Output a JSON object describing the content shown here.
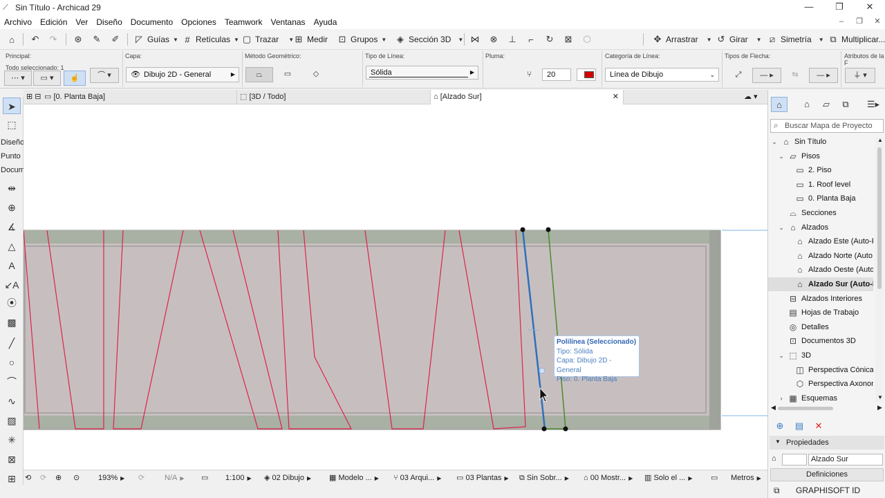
{
  "window": {
    "title": "Sin Título - Archicad 29",
    "controls": {
      "minimize": "—",
      "maximize": "❐",
      "close": "✕"
    },
    "doc_controls": {
      "minimize": "–",
      "restore": "❐",
      "close": "✕"
    }
  },
  "menu": [
    "Archivo",
    "Edición",
    "Ver",
    "Diseño",
    "Documento",
    "Opciones",
    "Teamwork",
    "Ventanas",
    "Ayuda"
  ],
  "toolbar": {
    "guias": "Guías",
    "reticulas": "Retículas",
    "trazar": "Trazar",
    "medir": "Medir",
    "grupos": "Grupos",
    "seccion3d": "Sección 3D",
    "arrastrar": "Arrastrar",
    "girar": "Girar",
    "simetria": "Simetría",
    "multiplicar": "Multiplicar..."
  },
  "infobox": {
    "principal_label": "Principal:",
    "todo_seleccionado": "Todo seleccionado: 1",
    "capa_label": "Capa:",
    "capa_value": "Dibujo 2D - General",
    "metodo_label": "Método Geométrico:",
    "tipo_linea_label": "Tipo de Línea:",
    "tipo_linea_value": "Sólida",
    "pluma_label": "Pluma:",
    "pluma_value": "20",
    "pluma_color": "#d40000",
    "categoria_label": "Categoría de Línea:",
    "categoria_value": "Línea de Dibujo",
    "flecha_label": "Tipos de Flecha:",
    "atributos_label": "Atributos de la F"
  },
  "tabs": [
    {
      "label": "[0. Planta Baja]"
    },
    {
      "label": "[3D / Todo]"
    },
    {
      "label": "[Alzado Sur]"
    }
  ],
  "toolbox": {
    "labels": [
      "Diseño",
      "Punto",
      "Docum"
    ]
  },
  "tooltip": {
    "title": "Polilínea (Seleccionado)",
    "tipo": "Tipo: Sólida",
    "capa": "Capa: Dibujo 2D - General",
    "piso": "Piso: 0. Planta Baja"
  },
  "colors": {
    "accent_blue": "#2f6fbd",
    "red_lines": "#e0204a",
    "green_line": "#4a8a2a",
    "wall_fill": "#c7bfbf",
    "wall_band": "#a9b0a4"
  },
  "navigator": {
    "search_placeholder": "Buscar Mapa de Proyecto",
    "tree": [
      {
        "label": "Sin Título",
        "icon": "house-icon",
        "twisty": "⌄"
      },
      {
        "label": "Pisos",
        "icon": "floors-icon",
        "twisty": "⌄"
      },
      {
        "label": "2. Piso",
        "icon": "floor-icon",
        "twisty": ""
      },
      {
        "label": "1. Roof level",
        "icon": "floor-icon",
        "twisty": ""
      },
      {
        "label": "0. Planta Baja",
        "icon": "floor-icon",
        "twisty": ""
      },
      {
        "label": "Secciones",
        "icon": "section-icon",
        "twisty": ""
      },
      {
        "label": "Alzados",
        "icon": "elevation-icon",
        "twisty": "⌄"
      },
      {
        "label": "Alzado Este (Auto-R",
        "icon": "elevation-icon",
        "twisty": ""
      },
      {
        "label": "Alzado Norte (Auto",
        "icon": "elevation-icon",
        "twisty": ""
      },
      {
        "label": "Alzado Oeste (Auto",
        "icon": "elevation-icon",
        "twisty": ""
      },
      {
        "label": "Alzado Sur (Auto-R",
        "icon": "elevation-icon",
        "twisty": "",
        "selected": true
      },
      {
        "label": "Alzados Interiores",
        "icon": "interior-elevation-icon",
        "twisty": ""
      },
      {
        "label": "Hojas de Trabajo",
        "icon": "worksheet-icon",
        "twisty": ""
      },
      {
        "label": "Detalles",
        "icon": "detail-icon",
        "twisty": ""
      },
      {
        "label": "Documentos 3D",
        "icon": "document3d-icon",
        "twisty": ""
      },
      {
        "label": "3D",
        "icon": "cube-icon",
        "twisty": "⌄"
      },
      {
        "label": "Perspectiva Cónica",
        "icon": "perspective-icon",
        "twisty": ""
      },
      {
        "label": "Perspectiva Axonom",
        "icon": "axonometry-icon",
        "twisty": ""
      },
      {
        "label": "Esquemas",
        "icon": "schedule-icon",
        "twisty": "›"
      }
    ],
    "properties_header": "Propiedades",
    "property_value": "Alzado Sur",
    "definitions_button": "Definiciones",
    "brand": "GRAPHISOFT ID"
  },
  "statusbar": {
    "zoom": "193%",
    "angle": "N/A",
    "scale": "1:100",
    "layer_combo": "02 Dibujo",
    "model_view": "Modelo ...",
    "pen_set": "03 Arqui...",
    "dimension": "03 Plantas",
    "override": "Sin Sobr...",
    "renovation": "00 Mostr...",
    "structure": "Solo el ...",
    "units": "Metros"
  }
}
